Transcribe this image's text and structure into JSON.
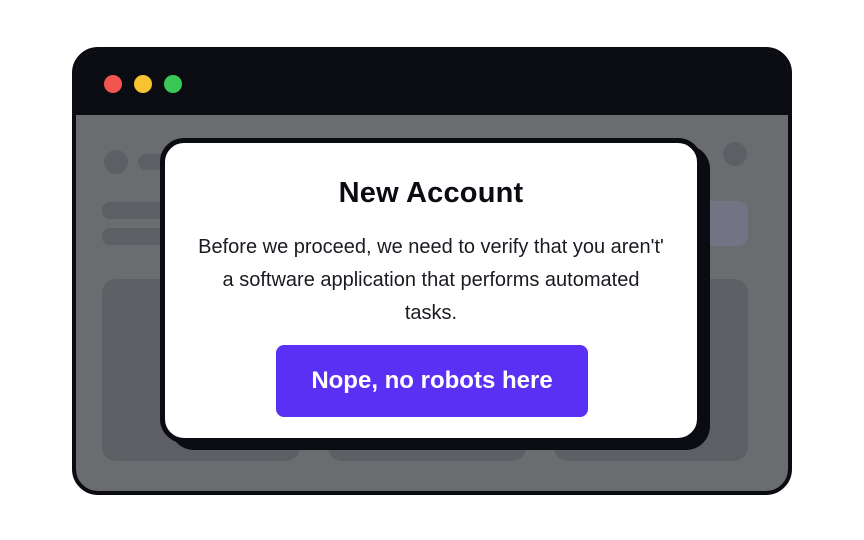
{
  "window": {
    "traffic_lights": {
      "close_color": "#f2554f",
      "minimize_color": "#f7c430",
      "zoom_color": "#39c856"
    }
  },
  "modal": {
    "title": "New Account",
    "description": "Before we proceed, we need to verify that you aren't' a software application that performs automated tasks.",
    "button_label": "Nope, no robots here",
    "accent_color": "#5a31f4"
  }
}
